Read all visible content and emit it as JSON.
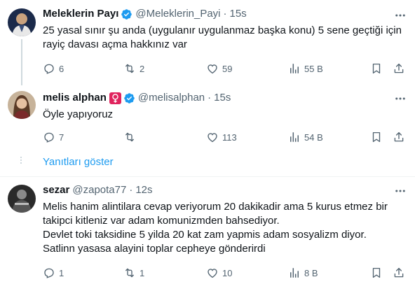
{
  "tweets": [
    {
      "name": "Meleklerin Payı",
      "handle": "@Meleklerin_Payi",
      "time": "15s",
      "text": "25 yasal sınır şu anda (uygulanır uygulanmaz başka konu) 5 sene geçtiği için rayiç davası açma hakkınız var",
      "replies": "6",
      "retweets": "2",
      "likes": "59",
      "views": "55 B"
    },
    {
      "name": "melis alphan",
      "handle": "@melisalphan",
      "time": "15s",
      "text": "Öyle yapıyoruz",
      "replies": "7",
      "retweets": "",
      "likes": "113",
      "views": "54 B"
    },
    {
      "name": "sezar",
      "handle": "@zapota77",
      "time": "12s",
      "lines": [
        "Melis hanim alintilara cevap veriyorum 20 dakikadir ama 5 kurus etmez bir takipci kitleniz var adam komunizmden bahsediyor.",
        "Devlet toki taksidine 5 yilda 20 kat zam yapmis adam sosyalizm diyor.",
        "Satlinn yasasa alayini toplar cepheye gönderirdi"
      ],
      "replies": "1",
      "retweets": "1",
      "likes": "10",
      "views": "8 B"
    }
  ],
  "show_replies": "Yanıtları göster",
  "colors": {
    "accent": "#1d9bf0",
    "secondary_text": "#536471",
    "verified": "#1d9bf0",
    "female_badge": "#e0245e"
  },
  "icons": {
    "verified": "verified-badge-icon",
    "female": "female-symbol-icon",
    "reply": "reply-icon",
    "retweet": "retweet-icon",
    "like": "heart-icon",
    "views": "views-icon",
    "bookmark": "bookmark-icon",
    "share": "share-icon",
    "more": "more-icon"
  }
}
